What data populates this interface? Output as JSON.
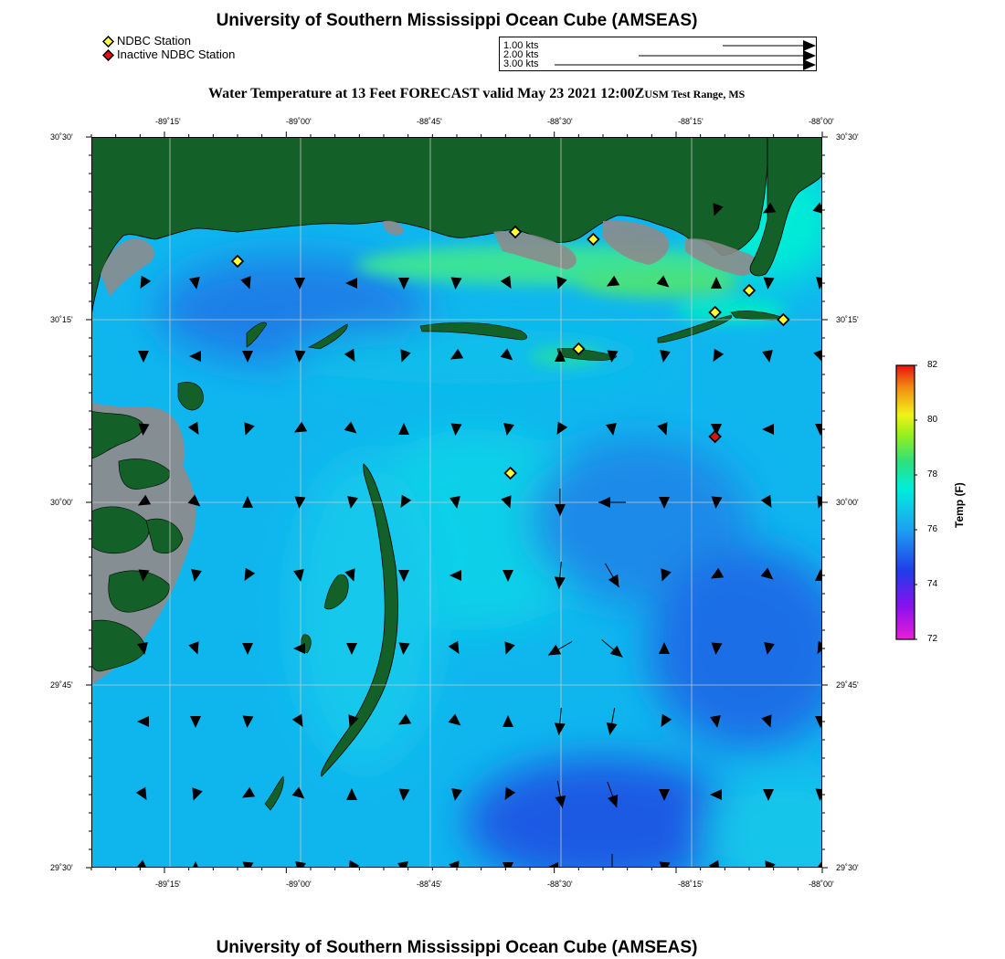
{
  "header": {
    "title": "University of Southern Mississippi Ocean Cube (AMSEAS)",
    "footer_title": "University of Southern Mississippi Ocean Cube (AMSEAS)"
  },
  "legend": {
    "items": [
      {
        "label": "NDBC Station",
        "color": "#ffff33",
        "icon": "yellow-diamond-icon"
      },
      {
        "label": "Inactive NDBC Station",
        "color": "#dd1111",
        "icon": "red-diamond-icon"
      }
    ]
  },
  "current_scale": {
    "labels": [
      "1.00 kts",
      "2.00 kts",
      "3.00 kts"
    ]
  },
  "map": {
    "subtitle": "Water Temperature at 13 Feet FORECAST valid May 23 2021 12:00Z",
    "region": "USM Test Range, MS",
    "lon_ticks": [
      "-89˚15'",
      "-89˚00'",
      "-88˚45'",
      "-88˚30'",
      "-88˚15'",
      "-88˚00'"
    ],
    "lat_ticks": [
      "30˚30'",
      "30˚15'",
      "30˚00'",
      "29˚45'",
      "29˚30'"
    ],
    "land_color": "#136128",
    "marsh_color": "#8c8c8c"
  },
  "colorbar": {
    "title": "Temp (F)",
    "ticks": [
      "82",
      "80",
      "78",
      "76",
      "74",
      "72"
    ],
    "colors": [
      "#e8139a",
      "#8800ee",
      "#1f3de8",
      "#1fa0f2",
      "#00f0d8",
      "#2ee07a",
      "#9af01a",
      "#f2f21a",
      "#f28a12",
      "#e81212"
    ]
  },
  "stations": [
    {
      "name": "active",
      "lon": -89.2,
      "lat": 30.33
    },
    {
      "name": "active",
      "lon": -88.63,
      "lat": 30.37
    },
    {
      "name": "active",
      "lon": -88.47,
      "lat": 30.36
    },
    {
      "name": "active",
      "lon": -88.15,
      "lat": 30.29
    },
    {
      "name": "active",
      "lon": -88.22,
      "lat": 30.26
    },
    {
      "name": "active",
      "lon": -88.08,
      "lat": 30.25
    },
    {
      "name": "active",
      "lon": -88.5,
      "lat": 30.21
    },
    {
      "name": "active",
      "lon": -88.64,
      "lat": 30.04
    },
    {
      "name": "inactive",
      "lon": -88.22,
      "lat": 30.09
    }
  ]
}
